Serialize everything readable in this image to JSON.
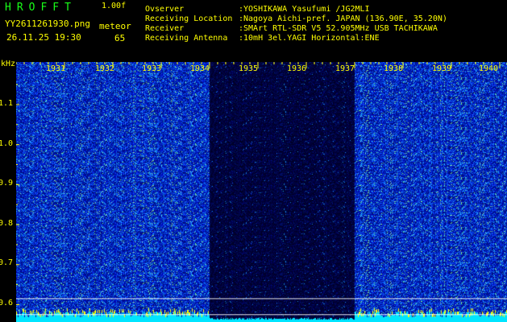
{
  "app": {
    "title": "HROFFT",
    "version": "1.00f"
  },
  "file": {
    "name": "YY2611261930.png",
    "timestamp": "26.11.25 19:30"
  },
  "detection": {
    "mode": "meteor",
    "count": "65"
  },
  "info": [
    {
      "label": "Ovserver",
      "value": ":YOSHIKAWA Yasufumi /JG2MLI"
    },
    {
      "label": "Receiving Location",
      "value": ":Nagoya Aichi-pref. JAPAN (136.90E, 35.20N)"
    },
    {
      "label": "Receiver",
      "value": ":SMArt RTL-SDR V5 52.905MHz USB TACHIKAWA"
    },
    {
      "label": "Receiving Antenna",
      "value": ":10mH 3el.YAGI Horizontal:ENE"
    }
  ],
  "axes": {
    "y_unit": "kHz",
    "y_ticks": [
      "1.1",
      "1.0",
      "0.9",
      "0.8",
      "0.7",
      "0.6"
    ],
    "x_ticks": [
      "1931",
      "1932",
      "1933",
      "1934",
      "1935",
      "1936",
      "1937",
      "1938",
      "1939",
      "1940"
    ]
  },
  "colors": {
    "label": "#ffff00",
    "title": "#19ff19",
    "signal_bar": "#00e5ff",
    "marker": "#ffffff"
  },
  "chart_data": {
    "type": "heatmap",
    "title": "",
    "xlabel": "",
    "ylabel": "kHz",
    "x_ticks": [
      "1931",
      "1932",
      "1933",
      "1934",
      "1935",
      "1936",
      "1937",
      "1938",
      "1939",
      "1940"
    ],
    "y_ticks": [
      1.1,
      1.0,
      0.9,
      0.8,
      0.7,
      0.6
    ],
    "ylim": [
      0.56,
      1.2
    ],
    "segments": [
      {
        "from": "1930",
        "to": "1934",
        "level": "high"
      },
      {
        "from": "1934",
        "to": "1937",
        "level": "low"
      },
      {
        "from": "1937",
        "to": "1940",
        "level": "high"
      }
    ],
    "colormap": [
      "#000033",
      "#0000c8",
      "#2060ff",
      "#60ff60",
      "#ffff00"
    ]
  }
}
